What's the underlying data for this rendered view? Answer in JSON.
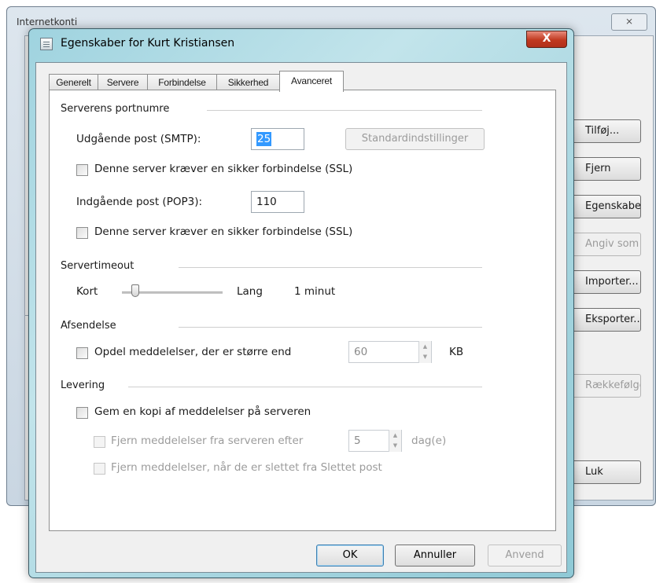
{
  "background_window": {
    "title": "Internetkonti",
    "close_glyph": "⨯",
    "buttons": [
      {
        "label": "Tilføj...",
        "disabled": false
      },
      {
        "label": "Fjern",
        "disabled": false
      },
      {
        "label": "Egenskaber",
        "disabled": false
      },
      {
        "label": "Angiv som standard",
        "disabled": true
      },
      {
        "label": "Importer...",
        "disabled": false
      },
      {
        "label": "Eksporter...",
        "disabled": false
      },
      {
        "label": "Rækkefølge...",
        "disabled": true
      },
      {
        "label": "Luk",
        "disabled": false
      }
    ]
  },
  "dialog": {
    "title": "Egenskaber for Kurt Kristiansen",
    "close_glyph": "X",
    "tabs": [
      {
        "label": "Generelt",
        "active": false
      },
      {
        "label": "Servere",
        "active": false
      },
      {
        "label": "Forbindelse",
        "active": false
      },
      {
        "label": "Sikkerhed",
        "active": false
      },
      {
        "label": "Avanceret",
        "active": true
      }
    ],
    "ports": {
      "heading": "Serverens portnumre",
      "smtp_label": "Udgående post (SMTP):",
      "smtp_value": "25",
      "defaults_button": "Standardindstillinger",
      "smtp_ssl_label": "Denne server kræver en sikker forbindelse (SSL)",
      "pop3_label": "Indgående post (POP3):",
      "pop3_value": "110",
      "pop3_ssl_label": "Denne server kræver en sikker forbindelse (SSL)"
    },
    "timeout": {
      "heading": "Servertimeout",
      "short_label": "Kort",
      "long_label": "Lang",
      "value_text": "1 minut",
      "slider_level": 0.1
    },
    "sending": {
      "heading": "Afsendelse",
      "split_label": "Opdel meddelelser, der er større end",
      "split_value": "60",
      "unit": "KB"
    },
    "delivery": {
      "heading": "Levering",
      "keep_copy_label": "Gem en kopi af meddelelser på serveren",
      "remove_after_label": "Fjern meddelelser fra serveren efter",
      "remove_after_value": "5",
      "days_unit": "dag(e)",
      "remove_deleted_label": "Fjern meddelelser, når de er slettet fra Slettet post"
    },
    "buttons": {
      "ok": "OK",
      "cancel": "Annuller",
      "apply": "Anvend"
    }
  }
}
